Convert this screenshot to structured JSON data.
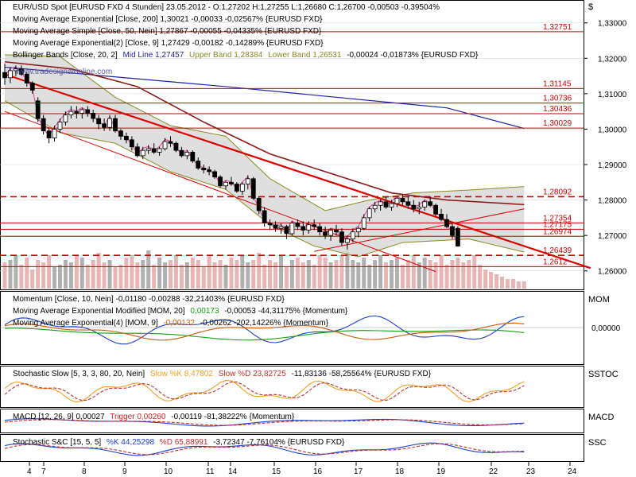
{
  "colors": {
    "frame": "#000000",
    "grid": "#d8d8d8",
    "bull_candle": "#ffffff",
    "bear_candle": "#000000",
    "ema200": "#1f1fa8",
    "sma50": "#8b1a1a",
    "ema9": "#e0409a",
    "bb_fill": "#d9d9d9",
    "bb_band": "#8a8a20",
    "trend": "#dd0000",
    "hline": "#cc0000",
    "vol_up": "#b0b0b0",
    "vol_down": "#e8b4b4",
    "mom": "#1a3fd0",
    "mom_ema20": "#10a010",
    "mom_ema9": "#d05a10",
    "stoch_k": "#f0a020",
    "stoch_d": "#c03030",
    "macd": "#1a3fd0",
    "trigger": "#d02020",
    "ssc_k": "#1a3fd0",
    "ssc_d": "#c03030"
  },
  "header": {
    "main_line": "EUR/USD Spot [EURUSD FXD  4 Stunden] 23.05.2012 - O:1,27202 H:1,27255 L:1,26680 C:1,26700 -0,00503 -0,39504%",
    "ema200": "Moving Average Exponential [Close, 200] 1,30021 -0,00033 -0,02567% {EURUSD FXD}",
    "sma50": "Moving Average Simple [Close, 50, Nein] 1,27867 -0,00055 -0,04335% {EURUSD FXD}",
    "ema9": "Moving Average Exponential(2) [Close, 9] 1,27429 -0,00182 -0,14289% {EURUSD FXD}",
    "bb_prefix": "Bollinger Bands [Close, 20, 2]",
    "bb_mid": "Mid Line 1,27457",
    "bb_upper": "Upper Band 1,28384",
    "bb_lower": "Lower Band 1,26531",
    "bb_tail": "-0,00024 -0,01873% {EURUSD FXD}",
    "watermark": "www.tradesignalonline.com"
  },
  "panels": {
    "mom": {
      "label": "MOM",
      "line1": "Momentum [Close, 10, Nein] -0,01180 -0,00288 -32,21403% {EURUSD FXD}",
      "line2_prefix": "Moving Average Exponential Modified [MOM, 20]",
      "line2_value": "0,00173",
      "line2_tail": "-0,00053 -44,31175% {Momentum}",
      "line3_prefix": "Moving Average Exponential(4) [MOM, 9]",
      "line3_value": "-0,00132",
      "line3_tail": "-0,00262 -202,14226% {Momentum}",
      "zero_label": "0,00000"
    },
    "sstoc": {
      "label": "SSTOC",
      "prefix": "Stochastic Slow [5, 3, 3, 80, 20, Nein]",
      "k": "Slow %K 8,47802",
      "d": "Slow %D 23,82725",
      "tail": "-11,83136 -58,25564% {EURUSD FXD}"
    },
    "macd": {
      "label": "MACD",
      "prefix": "MACD [12, 26, 9] 0,00027",
      "trigger": "Trigger 0,00260",
      "tail": "-0,00119 -81,38222% {Momentum}"
    },
    "ssc": {
      "label": "SSC",
      "prefix": "Stochastic S&C [15, 5, 5]",
      "k": "%K 44,25298",
      "d": "%D 65,88991",
      "tail": "-3,72347 -7,76104% {EURUSD FXD}"
    }
  },
  "axis": {
    "currency": "$",
    "y_ticks": [
      "1,33000",
      "1,32000",
      "1,31000",
      "1,30000",
      "1,29000",
      "1,28000",
      "1,27000",
      "1,26000"
    ],
    "x_ticks": [
      "4",
      "7",
      "8",
      "9",
      "10",
      "11",
      "14",
      "15",
      "16",
      "17",
      "18",
      "19",
      "22",
      "23",
      "24"
    ]
  },
  "levels": [
    {
      "label": "1,32751",
      "value": 1.32751
    },
    {
      "label": "1,31145",
      "value": 1.31145
    },
    {
      "label": "1,30736",
      "value": 1.30736
    },
    {
      "label": "1,30436",
      "value": 1.30436
    },
    {
      "label": "1,30029",
      "value": 1.30029
    },
    {
      "label": "1,28092",
      "value": 1.28092,
      "dashed": true
    },
    {
      "label": "1,27354",
      "value": 1.27354
    },
    {
      "label": "1,27175",
      "value": 1.27175
    },
    {
      "label": "1,26974",
      "value": 1.26974
    },
    {
      "label": "1,26439",
      "value": 1.26439,
      "dashed": true
    },
    {
      "label": "1,2612",
      "value": 1.2612
    }
  ],
  "chart_data": {
    "type": "candlestick",
    "title": "EUR/USD Spot [EURUSD FXD  4 Stunden]",
    "ylabel": "$",
    "ylim": [
      1.255,
      1.336
    ],
    "x_dates": [
      "4",
      "7",
      "8",
      "9",
      "10",
      "11",
      "14",
      "15",
      "16",
      "17",
      "18",
      "19",
      "22",
      "23",
      "24"
    ],
    "candles": [
      [
        1.316,
        1.3185,
        1.3125,
        1.3145
      ],
      [
        1.3145,
        1.3175,
        1.313,
        1.3165
      ],
      [
        1.3165,
        1.318,
        1.315,
        1.317
      ],
      [
        1.317,
        1.318,
        1.315,
        1.3155
      ],
      [
        1.3155,
        1.316,
        1.312,
        1.313
      ],
      [
        1.313,
        1.3135,
        1.31,
        1.311
      ],
      [
        1.308,
        1.309,
        1.302,
        1.303
      ],
      [
        1.303,
        1.304,
        1.2985,
        1.2995
      ],
      [
        1.2995,
        1.3005,
        1.296,
        1.2975
      ],
      [
        1.2975,
        1.301,
        1.2965,
        1.3
      ],
      [
        1.3,
        1.303,
        1.299,
        1.302
      ],
      [
        1.302,
        1.305,
        1.301,
        1.304
      ],
      [
        1.304,
        1.3065,
        1.303,
        1.305
      ],
      [
        1.305,
        1.3065,
        1.303,
        1.3045
      ],
      [
        1.3045,
        1.306,
        1.303,
        1.3055
      ],
      [
        1.3055,
        1.3065,
        1.3035,
        1.3045
      ],
      [
        1.3045,
        1.3055,
        1.302,
        1.303
      ],
      [
        1.303,
        1.304,
        1.3,
        1.3015
      ],
      [
        1.3015,
        1.303,
        1.2995,
        1.3005
      ],
      [
        1.3005,
        1.304,
        1.2995,
        1.303
      ],
      [
        1.303,
        1.304,
        1.299,
        1.2995
      ],
      [
        1.2995,
        1.3,
        1.297,
        1.298
      ],
      [
        1.298,
        1.299,
        1.296,
        1.297
      ],
      [
        1.297,
        1.298,
        1.294,
        1.295
      ],
      [
        1.295,
        1.296,
        1.292,
        1.2925
      ],
      [
        1.2925,
        1.295,
        1.2915,
        1.294
      ],
      [
        1.294,
        1.2955,
        1.293,
        1.2945
      ],
      [
        1.2945,
        1.296,
        1.293,
        1.2935
      ],
      [
        1.2935,
        1.295,
        1.2925,
        1.2945
      ],
      [
        1.2945,
        1.2975,
        1.294,
        1.2965
      ],
      [
        1.2965,
        1.298,
        1.295,
        1.296
      ],
      [
        1.296,
        1.2965,
        1.2935,
        1.294
      ],
      [
        1.294,
        1.295,
        1.292,
        1.2925
      ],
      [
        1.2925,
        1.294,
        1.2915,
        1.2935
      ],
      [
        1.2935,
        1.294,
        1.2905,
        1.291
      ],
      [
        1.291,
        1.292,
        1.2885,
        1.289
      ],
      [
        1.289,
        1.29,
        1.2875,
        1.2885
      ],
      [
        1.2885,
        1.2895,
        1.287,
        1.288
      ],
      [
        1.288,
        1.2885,
        1.286,
        1.2865
      ],
      [
        1.2865,
        1.287,
        1.2835,
        1.284
      ],
      [
        1.284,
        1.2855,
        1.283,
        1.285
      ],
      [
        1.285,
        1.2865,
        1.284,
        1.2845
      ],
      [
        1.2845,
        1.285,
        1.282,
        1.2825
      ],
      [
        1.2825,
        1.285,
        1.2815,
        1.2845
      ],
      [
        1.2845,
        1.287,
        1.283,
        1.286
      ],
      [
        1.286,
        1.2865,
        1.28,
        1.2805
      ],
      [
        1.2805,
        1.281,
        1.276,
        1.277
      ],
      [
        1.277,
        1.278,
        1.2725,
        1.2735
      ],
      [
        1.2735,
        1.2745,
        1.2715,
        1.273
      ],
      [
        1.273,
        1.274,
        1.271,
        1.272
      ],
      [
        1.272,
        1.2735,
        1.2705,
        1.2725
      ],
      [
        1.2725,
        1.273,
        1.269,
        1.2705
      ],
      [
        1.2705,
        1.274,
        1.27,
        1.2735
      ],
      [
        1.2735,
        1.2745,
        1.2715,
        1.2725
      ],
      [
        1.2725,
        1.274,
        1.27,
        1.2715
      ],
      [
        1.2715,
        1.274,
        1.2705,
        1.273
      ],
      [
        1.273,
        1.2745,
        1.2715,
        1.2725
      ],
      [
        1.2725,
        1.2735,
        1.27,
        1.271
      ],
      [
        1.271,
        1.2725,
        1.269,
        1.27
      ],
      [
        1.27,
        1.272,
        1.2685,
        1.2715
      ],
      [
        1.2715,
        1.273,
        1.27,
        1.271
      ],
      [
        1.271,
        1.272,
        1.267,
        1.268
      ],
      [
        1.268,
        1.27,
        1.266,
        1.269
      ],
      [
        1.269,
        1.272,
        1.268,
        1.271
      ],
      [
        1.271,
        1.2725,
        1.2695,
        1.272
      ],
      [
        1.272,
        1.276,
        1.2715,
        1.275
      ],
      [
        1.275,
        1.278,
        1.274,
        1.2775
      ],
      [
        1.2775,
        1.2795,
        1.2765,
        1.2785
      ],
      [
        1.2785,
        1.28,
        1.277,
        1.2795
      ],
      [
        1.2795,
        1.281,
        1.2775,
        1.278
      ],
      [
        1.278,
        1.28,
        1.277,
        1.279
      ],
      [
        1.279,
        1.281,
        1.278,
        1.2805
      ],
      [
        1.2805,
        1.2815,
        1.2785,
        1.2795
      ],
      [
        1.2795,
        1.281,
        1.2775,
        1.2785
      ],
      [
        1.2785,
        1.28,
        1.2765,
        1.2775
      ],
      [
        1.2775,
        1.2795,
        1.276,
        1.278
      ],
      [
        1.278,
        1.28,
        1.277,
        1.2795
      ],
      [
        1.2795,
        1.281,
        1.278,
        1.2785
      ],
      [
        1.2785,
        1.279,
        1.2755,
        1.276
      ],
      [
        1.276,
        1.2775,
        1.274,
        1.2745
      ],
      [
        1.2745,
        1.276,
        1.272,
        1.2725
      ],
      [
        1.2725,
        1.2735,
        1.269,
        1.27
      ],
      [
        1.272,
        1.2726,
        1.2668,
        1.267
      ]
    ],
    "ema200": [
      [
        0,
        1.3175
      ],
      [
        40,
        1.312
      ],
      [
        80,
        1.306
      ],
      [
        94,
        1.3002
      ]
    ],
    "sma50": [
      [
        0,
        1.319
      ],
      [
        12,
        1.317
      ],
      [
        24,
        1.312
      ],
      [
        36,
        1.302
      ],
      [
        48,
        1.293
      ],
      [
        60,
        1.287
      ],
      [
        70,
        1.282
      ],
      [
        80,
        1.28
      ],
      [
        94,
        1.2787
      ]
    ],
    "bb_upper": [
      [
        0,
        1.321
      ],
      [
        10,
        1.3205
      ],
      [
        20,
        1.309
      ],
      [
        30,
        1.301
      ],
      [
        40,
        1.298
      ],
      [
        48,
        1.286
      ],
      [
        58,
        1.277
      ],
      [
        66,
        1.28
      ],
      [
        74,
        1.282
      ],
      [
        86,
        1.283
      ],
      [
        94,
        1.2838
      ]
    ],
    "bb_lower": [
      [
        0,
        1.308
      ],
      [
        10,
        1.299
      ],
      [
        20,
        1.296
      ],
      [
        30,
        1.288
      ],
      [
        40,
        1.283
      ],
      [
        48,
        1.273
      ],
      [
        56,
        1.267
      ],
      [
        64,
        1.264
      ],
      [
        72,
        1.268
      ],
      [
        84,
        1.269
      ],
      [
        94,
        1.2653
      ]
    ],
    "trend_lines": [
      {
        "from": [
          0,
          1.3155
        ],
        "to": [
          106,
          1.2608
        ]
      },
      {
        "from": [
          0,
          1.305
        ],
        "to": [
          78,
          1.2598
        ]
      },
      {
        "from": [
          56,
          1.2655
        ],
        "to": [
          94,
          1.2775
        ]
      }
    ],
    "volume": [
      0.55,
      0.6,
      0.7,
      0.5,
      0.65,
      0.4,
      0.6,
      0.55,
      0.7,
      0.45,
      0.5,
      0.6,
      0.55,
      0.7,
      0.65,
      0.5,
      0.6,
      0.75,
      0.55,
      0.6,
      0.45,
      0.5,
      0.65,
      0.7,
      0.55,
      0.6,
      0.8,
      0.5,
      0.65,
      0.55,
      0.6,
      0.7,
      0.5,
      0.55,
      0.65,
      0.6,
      0.45,
      0.7,
      0.55,
      0.6,
      0.5,
      0.65,
      0.6,
      0.7,
      0.55,
      0.6,
      0.75,
      0.5,
      0.6,
      0.55,
      0.7,
      0.45,
      0.6,
      0.65,
      0.55,
      0.6,
      0.5,
      0.7,
      0.65,
      0.55,
      0.6,
      0.7,
      0.8,
      0.6,
      0.55,
      0.65,
      0.5,
      0.6,
      0.7,
      0.55,
      0.6,
      0.65,
      0.5,
      0.6,
      0.7,
      0.55,
      0.65,
      0.6,
      0.55,
      0.7,
      0.5,
      0.6,
      0.65,
      0.55,
      0.6,
      0.7,
      0.5,
      0.4,
      0.35,
      0.3,
      0.25,
      0.2,
      0.2,
      0.15,
      0.15
    ]
  }
}
